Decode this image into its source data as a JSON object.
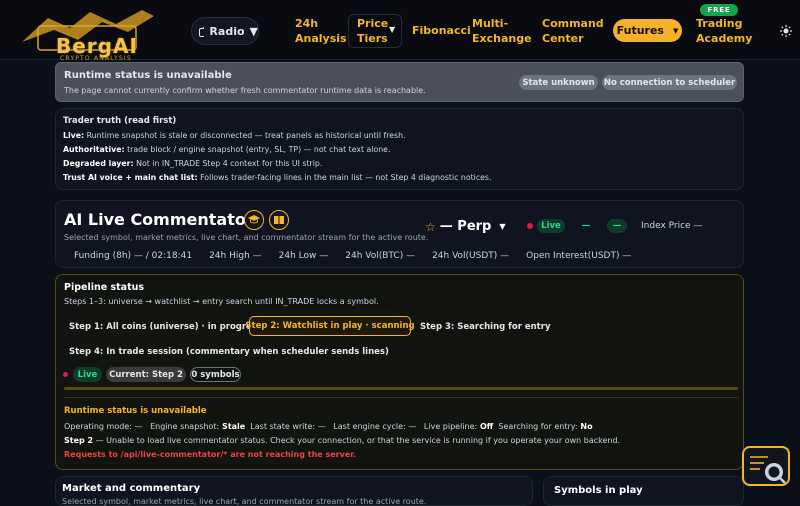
{
  "nav": {
    "logo_text": "BergAI",
    "logo_sub": "CRYPTO ANALYSIS",
    "radio_label": "Radio",
    "links": [
      {
        "label": "24h\nAnalysis"
      },
      {
        "label": "Price\nTiers"
      },
      {
        "label": "Fibonacci"
      },
      {
        "label": "Multi-\nExchange"
      },
      {
        "label": "Command\nCenter"
      }
    ],
    "futures_label": "Futures",
    "free_badge": "FREE",
    "academy_label": "Trading\nAcademy"
  },
  "runtime_banner": {
    "title": "Runtime status is unavailable",
    "subtitle": "The page cannot currently confirm whether fresh commentator runtime data is reachable.",
    "pill_state": "State unknown",
    "pill_scheduler": "No connection to scheduler"
  },
  "trader_truth": {
    "heading": "Trader truth (read first)",
    "rows": [
      {
        "label": "Live:",
        "text": " Runtime snapshot is stale or disconnected — treat panels as historical until fresh."
      },
      {
        "label": "Authoritative:",
        "text": " trade block / engine snapshot (entry, SL, TP) — not chat text alone."
      },
      {
        "label": "Degraded layer:",
        "text": " Not in IN_TRADE Step 4 context for this UI strip."
      },
      {
        "label": "Trust AI voice + main chat list:",
        "text": " Follows trader-facing lines in the main list — not Step 4 diagnostic notices."
      }
    ]
  },
  "commentator": {
    "title": "AI Live Commentator",
    "subtitle": "Selected symbol, market metrics, live chart, and commentator stream for the active route.",
    "symbol": "— Perp",
    "live_label": "Live",
    "dash1": "—",
    "dash2": "—",
    "index_price": "Index Price —",
    "metrics": [
      "Funding (8h) — / 02:18:41",
      "24h High —",
      "24h Low —",
      "24h Vol(BTC) —",
      "24h Vol(USDT) —",
      "Open Interest(USDT) —"
    ]
  },
  "pipeline": {
    "heading": "Pipeline status",
    "subtitle": "Steps 1–3: universe → watchlist → entry search until IN_TRADE locks a symbol.",
    "steps": [
      "Step 1: All coins (universe) · in progress",
      "Step 2: Watchlist in play · scanning",
      "Step 3: Searching for entry",
      "Step 4: In trade session (commentary when scheduler sends lines)"
    ],
    "live_chip": "Live",
    "current_chip": "Current: Step 2",
    "symbols_chip": "0 symbols",
    "error_heading": "Runtime status is unavailable",
    "status_line": [
      {
        "label": "Operating mode:",
        "text": " — ",
        "bold": false
      },
      {
        "label": "Engine snapshot:",
        "text": " Stale",
        "bold": true
      },
      {
        "label": "Last state write:",
        "text": " — ",
        "bold": false
      },
      {
        "label": "Last engine cycle:",
        "text": " — ",
        "bold": false
      },
      {
        "label": "Live pipeline:",
        "text": " Off",
        "bold": true
      },
      {
        "label": "Searching for entry:",
        "text": " No",
        "bold": true
      }
    ],
    "step2_label": "Step 2",
    "step2_text": " — Unable to load live commentator status. Check your connection, or that the service is running if you operate your own backend.",
    "red_text": "Requests to /api/live-commentator/* are not reaching the server."
  },
  "market": {
    "heading": "Market and commentary",
    "subtitle": "Selected symbol, market metrics, live chart, and commentator stream for the active route."
  },
  "symbols_panel": {
    "heading": "Symbols in play"
  },
  "colors": {
    "accent": "#f5b52b",
    "live_green": "#34d399",
    "error_red": "#ef4444"
  }
}
